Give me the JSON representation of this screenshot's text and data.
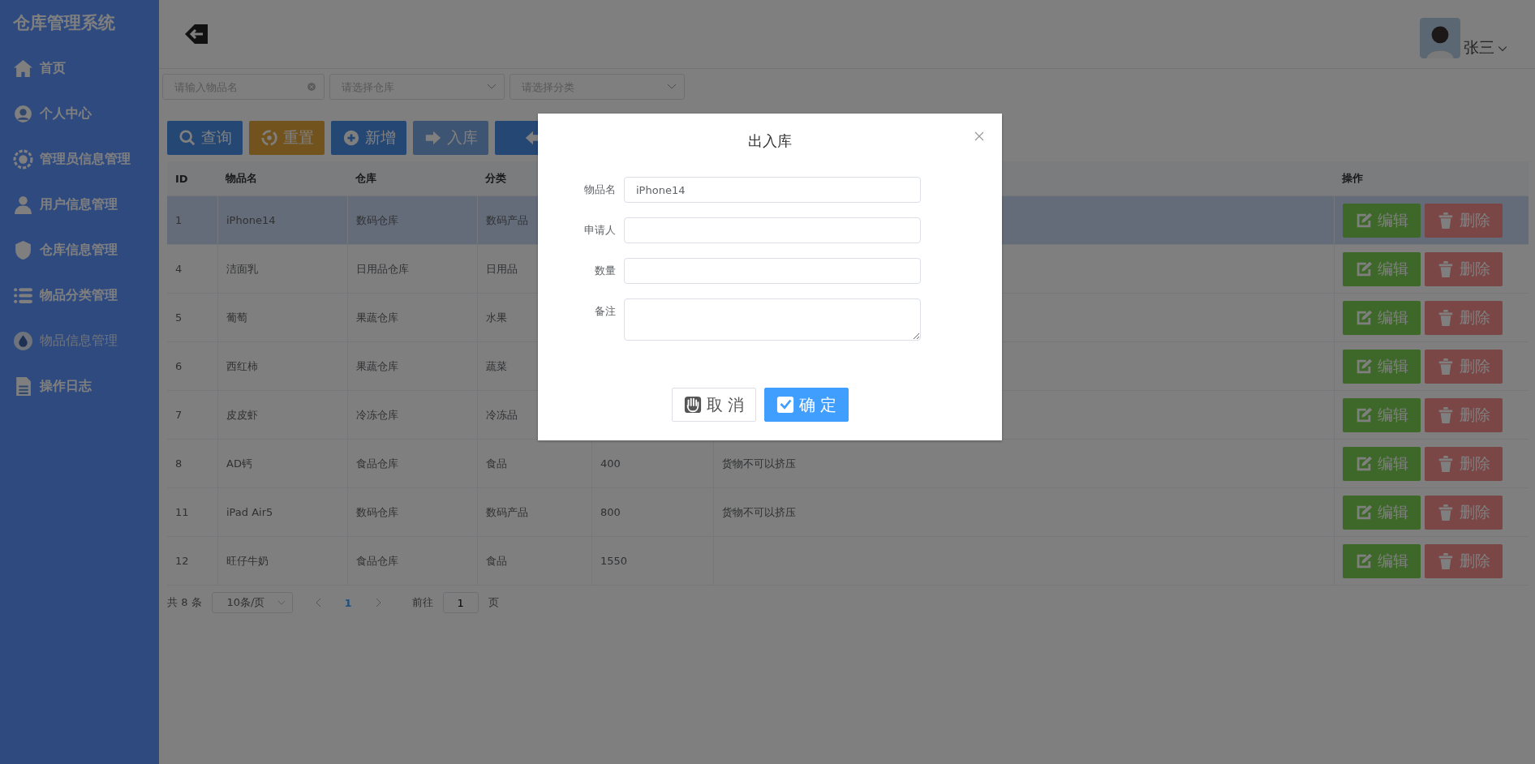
{
  "app": {
    "title": "仓库管理系统"
  },
  "sidebar": {
    "items": [
      {
        "label": "首页",
        "selected": false
      },
      {
        "label": "个人中心",
        "selected": false
      },
      {
        "label": "管理员信息管理",
        "selected": false
      },
      {
        "label": "用户信息管理",
        "selected": false
      },
      {
        "label": "仓库信息管理",
        "selected": false
      },
      {
        "label": "物品分类管理",
        "selected": false
      },
      {
        "label": "物品信息管理",
        "selected": true
      },
      {
        "label": "操作日志",
        "selected": false
      }
    ]
  },
  "header": {
    "user": "张三"
  },
  "filters": [
    {
      "placeholder": "请输入物品名",
      "kind": "search"
    },
    {
      "placeholder": "请选择仓库",
      "kind": "select"
    },
    {
      "placeholder": "请选择分类",
      "kind": "select"
    }
  ],
  "toolbar": [
    {
      "label": "查询",
      "kind": "search"
    },
    {
      "label": "重置",
      "kind": "reset"
    },
    {
      "label": "新增",
      "kind": "add"
    },
    {
      "label": "入库",
      "kind": "in"
    },
    {
      "kind": "out"
    }
  ],
  "table": {
    "columns": [
      "ID",
      "物品名",
      "仓库",
      "分类",
      null,
      null,
      "操作"
    ],
    "rows": [
      {
        "id": "1",
        "name": "iPhone14",
        "warehouse": "数码仓库",
        "category": "数码产品",
        "selected": true,
        "edit": "编辑",
        "delete": "删除"
      },
      {
        "id": "4",
        "name": "洁面乳",
        "warehouse": "日用品仓库",
        "category": "日用品",
        "selected": false,
        "edit": "编辑",
        "delete": "删除"
      },
      {
        "id": "5",
        "name": "葡萄",
        "warehouse": "果蔬仓库",
        "category": "水果",
        "selected": false,
        "edit": "编辑",
        "delete": "删除"
      },
      {
        "id": "6",
        "name": "西红柿",
        "warehouse": "果蔬仓库",
        "category": "蔬菜",
        "selected": false,
        "edit": "编辑",
        "delete": "删除"
      },
      {
        "id": "7",
        "name": "皮皮虾",
        "warehouse": "冷冻仓库",
        "category": "冷冻品",
        "selected": false,
        "edit": "编辑",
        "delete": "删除"
      },
      {
        "id": "8",
        "name": "AD钙",
        "warehouse": "食品仓库",
        "category": "食品",
        "quantity": "400",
        "remark": "货物不可以挤压",
        "selected": false,
        "edit": "编辑",
        "delete": "删除"
      },
      {
        "id": "11",
        "name": "iPad Air5",
        "warehouse": "数码仓库",
        "category": "数码产品",
        "quantity": "800",
        "remark": "货物不可以挤压",
        "selected": false,
        "edit": "编辑",
        "delete": "删除"
      },
      {
        "id": "12",
        "name": "旺仔牛奶",
        "warehouse": "食品仓库",
        "category": "食品",
        "quantity": "1550",
        "selected": false,
        "edit": "编辑",
        "delete": "删除"
      }
    ]
  },
  "pagination": {
    "total": "共 8 条",
    "page_size": "10条/页",
    "pages": [
      {
        "label": "1",
        "selected": true
      }
    ],
    "goto_label": "前往",
    "goto_value": "1",
    "page_unit": "页"
  },
  "dialog": {
    "title": "出入库",
    "fields": [
      {
        "label": "物品名",
        "value": "iPhone14",
        "kind": "input"
      },
      {
        "label": "申请人",
        "kind": "input"
      },
      {
        "label": "数量",
        "kind": "input"
      },
      {
        "label": "备注",
        "kind": "textarea"
      }
    ],
    "buttons": [
      {
        "label": "取 消",
        "kind": "cancel"
      },
      {
        "label": "确 定",
        "kind": "confirm"
      }
    ]
  }
}
